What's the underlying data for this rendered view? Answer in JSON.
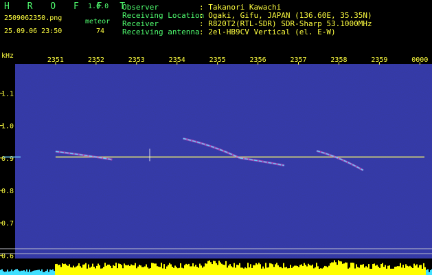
{
  "header": {
    "app_name": "H R O F F T",
    "version": "1.0.0",
    "filename": "2509062350.png",
    "datetime": "25.09.06 23:50",
    "type_label": "meteor",
    "type_count": "74",
    "fields": [
      {
        "label": "Observer",
        "value": ": Takanori Kawachi"
      },
      {
        "label": "Receiving Location",
        "value": ": Ogaki, Gifu, JAPAN (136.60E, 35.35N)"
      },
      {
        "label": "Receiver",
        "value": ": R820T2(RTL-SDR) SDR-Sharp 53.1000MHz"
      },
      {
        "label": "Receiving antenna",
        "value": ": 2el-HB9CV Vertical (el. E-W)"
      }
    ]
  },
  "chart_data": {
    "type": "heatmap",
    "ylabel": "kHz",
    "ylim": [
      0.59,
      1.19
    ],
    "y_ticks": [
      "1.1",
      "1.0",
      "0.9",
      "0.8",
      "0.7",
      "0.6"
    ],
    "y_tick_values": [
      1.1,
      1.0,
      0.9,
      0.8,
      0.7,
      0.6
    ],
    "x_ticks": [
      "2351",
      "2352",
      "2353",
      "2354",
      "2355",
      "2356",
      "2357",
      "2358",
      "2359",
      "0000"
    ],
    "x_tick_minutes": [
      1,
      2,
      3,
      4,
      5,
      6,
      7,
      8,
      9,
      10
    ],
    "xlim_minutes": [
      0,
      10.3
    ],
    "carrier_khz": 0.903,
    "reference_lines_khz": [
      0.62,
      0.605
    ],
    "meteor_traces": [
      {
        "t_start": 1.0,
        "t_end": 2.4,
        "f_start": 0.92,
        "f_end": 0.895
      },
      {
        "t_start": 4.15,
        "t_end": 5.55,
        "f_start": 0.96,
        "f_end": 0.9
      },
      {
        "t_start": 5.55,
        "t_end": 6.65,
        "f_start": 0.9,
        "f_end": 0.877
      },
      {
        "t_start": 7.45,
        "t_end": 8.6,
        "f_start": 0.922,
        "f_end": 0.862
      }
    ],
    "colors": {
      "background": "#000000",
      "noise": "#0a0a9a",
      "carrier": "#f0f070",
      "axis_text": "#ffff40",
      "header_text": "#50ff70",
      "header_value": "#40e0ff",
      "histogram": "#ffff00",
      "histogram_cyan": "#40e0ff"
    }
  }
}
